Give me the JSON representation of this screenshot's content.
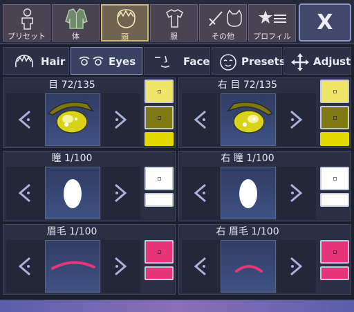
{
  "categories": [
    {
      "label": "プリセット",
      "icon": "person-icon"
    },
    {
      "label": "体",
      "icon": "jacket-icon"
    },
    {
      "label": "頭",
      "icon": "head-icon",
      "selected": true
    },
    {
      "label": "服",
      "icon": "shirt-icon"
    },
    {
      "label": "その他",
      "icon": "sword-cat-icon"
    },
    {
      "label": "プロフィル",
      "icon": "star-list-icon"
    }
  ],
  "close_label": "X",
  "tabs": [
    {
      "label": "Hair",
      "icon": "hair-icon"
    },
    {
      "label": "Eyes",
      "icon": "eyes-icon",
      "selected": true
    },
    {
      "label": "Face",
      "icon": "face-icon"
    },
    {
      "label": "Presets",
      "icon": "presets-face-icon"
    },
    {
      "label": "Adjust",
      "icon": "move-arrows-icon"
    }
  ],
  "panels": [
    {
      "title": "目 72/135",
      "preview": "eye-left",
      "swatches": [
        "#eee56a",
        "#807a12",
        "#e2d900"
      ]
    },
    {
      "title": "右 目 72/135",
      "preview": "eye-right",
      "swatches": [
        "#eee56a",
        "#807a12",
        "#e2d900"
      ]
    },
    {
      "title": "瞳 1/100",
      "preview": "pupil",
      "swatches": [
        "#ffffff",
        "#ffffff"
      ]
    },
    {
      "title": "右 瞳 1/100",
      "preview": "pupil",
      "swatches": [
        "#ffffff",
        "#ffffff"
      ]
    },
    {
      "title": "眉毛 1/100",
      "preview": "brow-left",
      "swatches": [
        "#e8357a",
        "#e8357a"
      ]
    },
    {
      "title": "右 眉毛 1/100",
      "preview": "brow-right",
      "swatches": [
        "#e8357a",
        "#e8357a"
      ]
    }
  ],
  "colors": {
    "accent_selected": "#cdbb7d",
    "eye_yellow": "#e2d900",
    "brow_pink": "#e8357a"
  }
}
